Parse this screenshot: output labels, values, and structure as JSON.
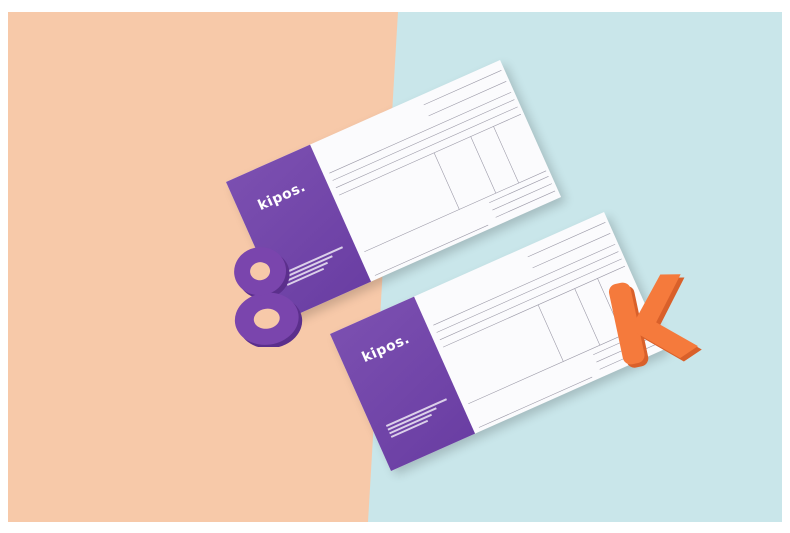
{
  "scene": {
    "colors": {
      "peach": "#f7c9a9",
      "mint": "#c9e6ea",
      "purple": "#6f42a8",
      "orange": "#f57a3c",
      "paper": "#fbfbfd"
    }
  },
  "cards": [
    {
      "logo": "kipos."
    },
    {
      "logo": "kipos."
    }
  ],
  "objects": {
    "number": "8",
    "letter": "K"
  }
}
